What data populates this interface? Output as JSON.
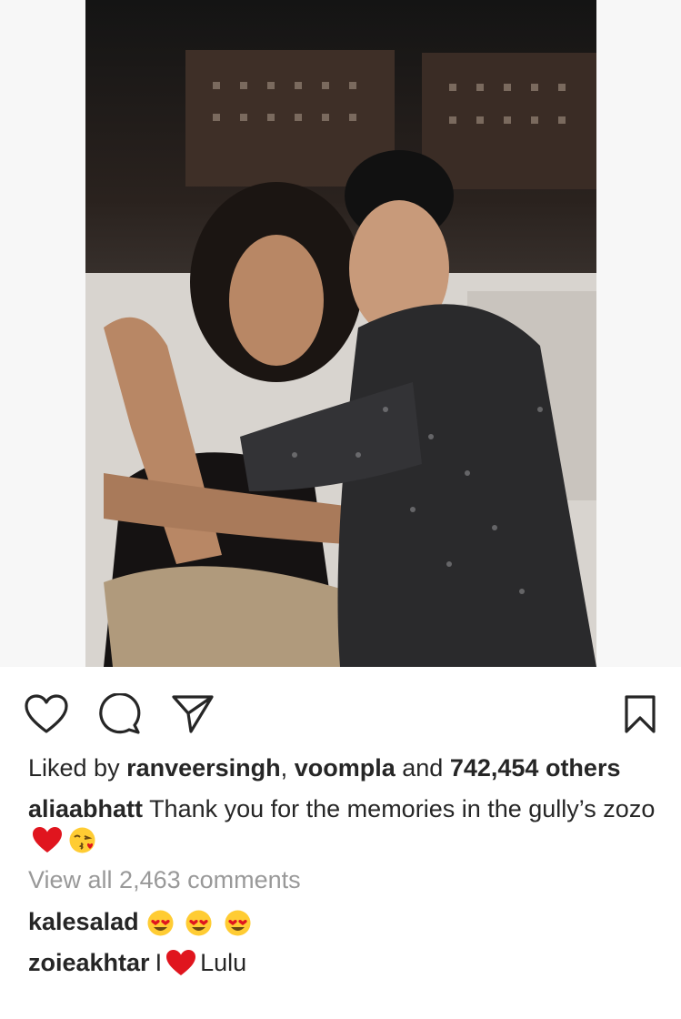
{
  "post": {
    "likes": {
      "prefix": "Liked by",
      "user1": "ranveersingh",
      "sep": ",",
      "user2": "voompla",
      "and": "and",
      "count": "742,454",
      "others": "others"
    },
    "caption": {
      "username": "aliaabhatt",
      "text": "Thank you for the memories in the gully’s zozo"
    },
    "view_all": "View all 2,463 comments",
    "comments": [
      {
        "username": "kalesalad",
        "text": ""
      },
      {
        "username": "zoieakhtar",
        "text_before": "I",
        "text_after": "Lulu"
      }
    ]
  },
  "colors": {
    "text": "#262626",
    "muted": "#999999",
    "heart_red": "#e0151e",
    "emoji_yellow": "#ffcc33"
  },
  "icons": [
    "heart-icon",
    "comment-icon",
    "share-icon",
    "bookmark-icon",
    "red-heart-emoji",
    "kiss-emoji",
    "heart-eyes-emoji"
  ]
}
